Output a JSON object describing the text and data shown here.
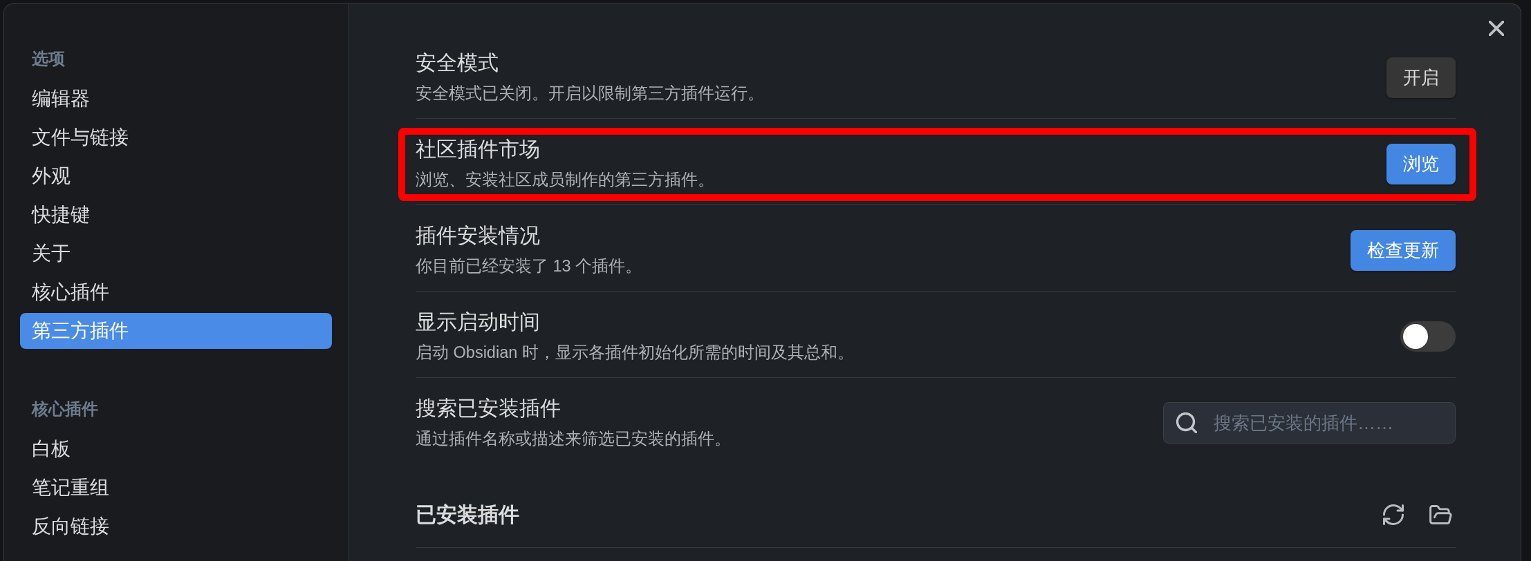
{
  "sidebar": {
    "groups": [
      {
        "title": "选项",
        "items": [
          {
            "label": "编辑器",
            "selected": false
          },
          {
            "label": "文件与链接",
            "selected": false
          },
          {
            "label": "外观",
            "selected": false
          },
          {
            "label": "快捷键",
            "selected": false
          },
          {
            "label": "关于",
            "selected": false
          },
          {
            "label": "核心插件",
            "selected": false
          },
          {
            "label": "第三方插件",
            "selected": true
          }
        ]
      },
      {
        "title": "核心插件",
        "items": [
          {
            "label": "白板",
            "selected": false
          },
          {
            "label": "笔记重组",
            "selected": false
          },
          {
            "label": "反向链接",
            "selected": false
          }
        ]
      }
    ]
  },
  "settings": [
    {
      "title": "安全模式",
      "description": "安全模式已关闭。开启以限制第三方插件运行。",
      "highlighted": false,
      "control": {
        "kind": "button",
        "label": "开启",
        "accent": false
      }
    },
    {
      "title": "社区插件市场",
      "description": "浏览、安装社区成员制作的第三方插件。",
      "highlighted": true,
      "control": {
        "kind": "button",
        "label": "浏览",
        "accent": true
      }
    },
    {
      "title": "插件安装情况",
      "description": "你目前已经安装了 13 个插件。",
      "highlighted": false,
      "control": {
        "kind": "button",
        "label": "检查更新",
        "accent": true
      }
    },
    {
      "title": "显示启动时间",
      "description": "启动 Obsidian 时，显示各插件初始化所需的时间及其总和。",
      "highlighted": false,
      "control": {
        "kind": "toggle",
        "on": false
      }
    },
    {
      "title": "搜索已安装插件",
      "description": "通过插件名称或描述来筛选已安装的插件。",
      "highlighted": false,
      "control": {
        "kind": "search",
        "placeholder": "搜索已安装的插件……"
      }
    }
  ],
  "installed_section": {
    "title": "已安装插件"
  }
}
